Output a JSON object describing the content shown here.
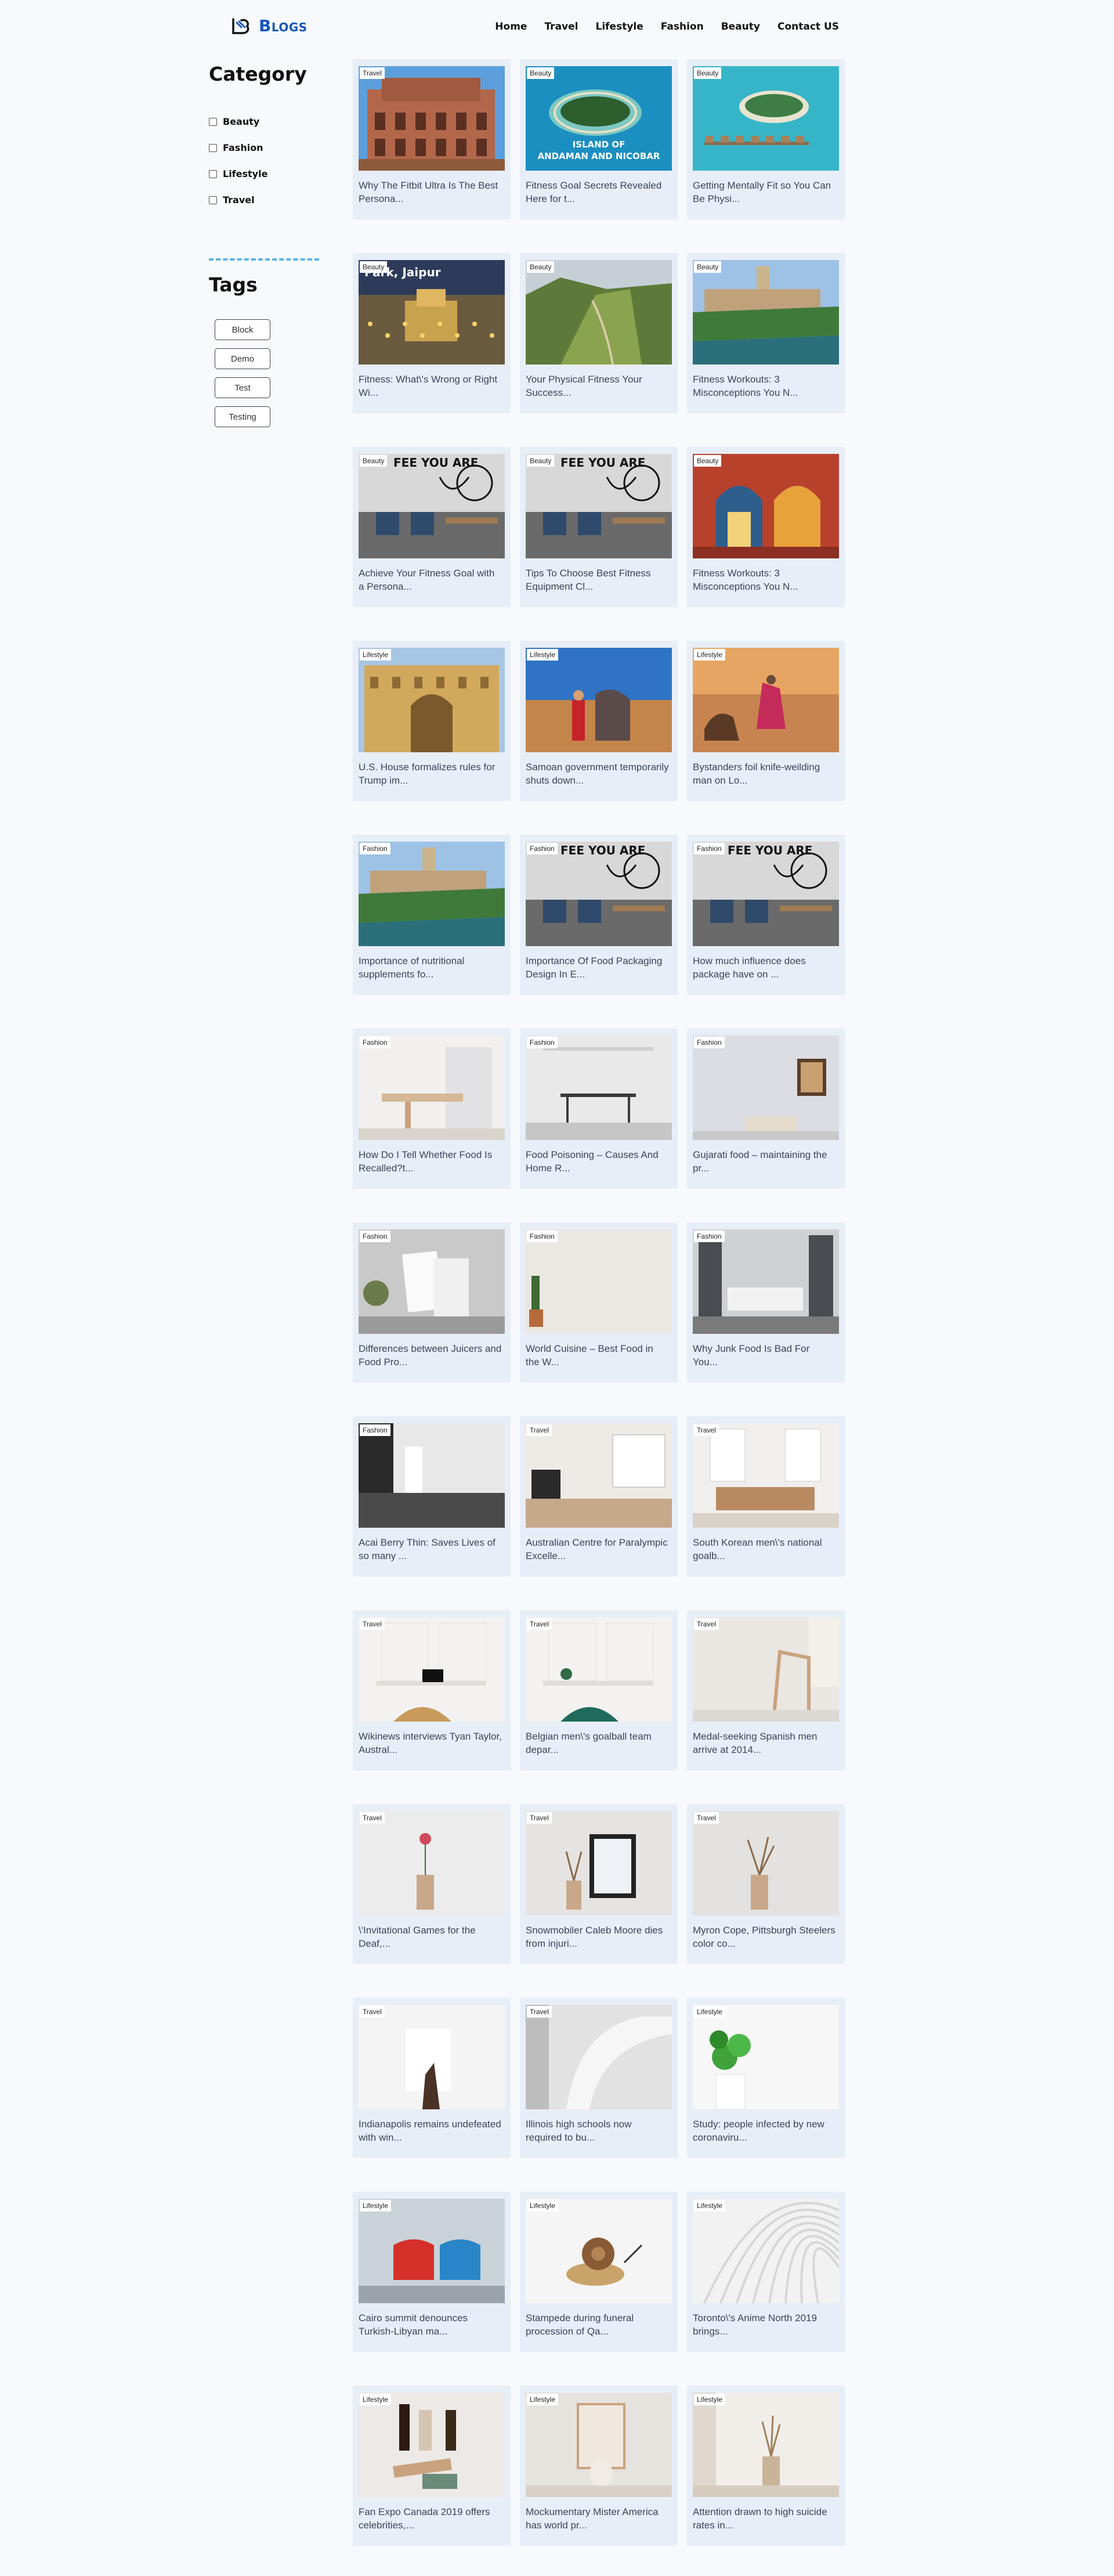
{
  "header": {
    "logo_text": "Blogs",
    "nav": [
      "Home",
      "Travel",
      "Lifestyle",
      "Fashion",
      "Beauty",
      "Contact US"
    ]
  },
  "sidebar": {
    "category_title": "Category",
    "categories": [
      "Beauty",
      "Fashion",
      "Lifestyle",
      "Travel"
    ],
    "tags_title": "Tags",
    "tags": [
      "Block",
      "Demo",
      "Test",
      "Testing"
    ]
  },
  "colors": {
    "accent": "#1557b8",
    "card_bg": "#e7eef8",
    "divider": "#5fb3e3"
  },
  "posts": [
    {
      "category": "Travel",
      "title": "Why The Fitbit Ultra Is The Best Persona...",
      "scene": "palace"
    },
    {
      "category": "Beauty",
      "title": "Fitness Goal Secrets Revealed Here for t...",
      "scene": "island",
      "overlay": "ISLAND OF ANDAMAN AND NICOBAR"
    },
    {
      "category": "Beauty",
      "title": "Getting Mentally Fit so You Can Be Physi...",
      "scene": "resort"
    },
    {
      "category": "Beauty",
      "title": "Fitness: What\\'s Wrong or Right Wi...",
      "scene": "jaipur",
      "overlay": "Park, Jaipur"
    },
    {
      "category": "Beauty",
      "title": "Your Physical Fitness Your Success...",
      "scene": "hill"
    },
    {
      "category": "Beauty",
      "title": "Fitness Workouts: 3 Misconceptions You N...",
      "scene": "fort"
    },
    {
      "category": "Beauty",
      "title": "Achieve Your Fitness Goal with a Persona...",
      "scene": "cafe",
      "overlay": "FEE YOU ARE"
    },
    {
      "category": "Beauty",
      "title": "Tips To Choose Best Fitness Equipment Cl...",
      "scene": "cafe",
      "overlay": "FEE YOU ARE"
    },
    {
      "category": "Beauty",
      "title": "Fitness Workouts: 3 Misconceptions You N...",
      "scene": "haveli"
    },
    {
      "category": "Lifestyle",
      "title": "U.S. House formalizes rules for Trump im...",
      "scene": "amber"
    },
    {
      "category": "Lifestyle",
      "title": "Samoan government temporarily shuts down...",
      "scene": "elephant"
    },
    {
      "category": "Lifestyle",
      "title": "Bystanders foil knife-weilding man on Lo...",
      "scene": "desert"
    },
    {
      "category": "Fashion",
      "title": "Importance of nutritional supplements fo...",
      "scene": "fort"
    },
    {
      "category": "Fashion",
      "title": "Importance Of Food Packaging Design In E...",
      "scene": "cafe",
      "overlay": "FEE YOU ARE"
    },
    {
      "category": "Fashion",
      "title": "How much influence does package have on ...",
      "scene": "cafe",
      "overlay": "FEE YOU ARE"
    },
    {
      "category": "Fashion",
      "title": "How Do I Tell Whether Food Is Recalled?t...",
      "scene": "kitchen"
    },
    {
      "category": "Fashion",
      "title": "Food Poisoning – Causes And Home R...",
      "scene": "dining"
    },
    {
      "category": "Fashion",
      "title": "Gujarati food – maintaining the pr...",
      "scene": "frame"
    },
    {
      "category": "Fashion",
      "title": "Differences between Juicers and Food Pro...",
      "scene": "canvas"
    },
    {
      "category": "Fashion",
      "title": "World Cuisine – Best Food in the W...",
      "scene": "cactus"
    },
    {
      "category": "Fashion",
      "title": "Why Junk Food Is Bad For You...",
      "scene": "bedroom"
    },
    {
      "category": "Fashion",
      "title": "Acai Berry Thin: Saves Lives of so many ...",
      "scene": "emptyroom"
    },
    {
      "category": "Travel",
      "title": "Australian Centre for Paralympic Excelle...",
      "scene": "livingroom"
    },
    {
      "category": "Travel",
      "title": "South Korean men\\'s national goalb...",
      "scene": "sofa"
    },
    {
      "category": "Travel",
      "title": "Wikinews interviews Tyan Taylor, Austral...",
      "scene": "desk"
    },
    {
      "category": "Travel",
      "title": "Belgian men\\'s goalball team depar...",
      "scene": "console"
    },
    {
      "category": "Travel",
      "title": "Medal-seeking Spanish men arrive at 2014...",
      "scene": "chair"
    },
    {
      "category": "Travel",
      "title": "\\'Invitational Games for the Deaf,...",
      "scene": "vase"
    },
    {
      "category": "Travel",
      "title": "Snowmobiler Caleb Moore dies from injuri...",
      "scene": "vaseframe"
    },
    {
      "category": "Travel",
      "title": "Myron Cope, Pittsburgh Steelers color co...",
      "scene": "vase2"
    },
    {
      "category": "Travel",
      "title": "Indianapolis remains undefeated with win...",
      "scene": "hand"
    },
    {
      "category": "Travel",
      "title": "Illinois high schools now required to bu...",
      "scene": "curve"
    },
    {
      "category": "Lifestyle",
      "title": "Study: people infected by new coronaviru...",
      "scene": "plant"
    },
    {
      "category": "Lifestyle",
      "title": "Cairo summit denounces Turkish-Libyan ma...",
      "scene": "chairs"
    },
    {
      "category": "Lifestyle",
      "title": "Stampede during funeral procession of Qa...",
      "scene": "snail"
    },
    {
      "category": "Lifestyle",
      "title": "Toronto\\'s Anime North 2019 brings...",
      "scene": "arch"
    },
    {
      "category": "Lifestyle",
      "title": "Fan Expo Canada 2019 offers celebrities,...",
      "scene": "bottles"
    },
    {
      "category": "Lifestyle",
      "title": "Mockumentary Mister America has world pr...",
      "scene": "mirror"
    },
    {
      "category": "Lifestyle",
      "title": "Attention drawn to high suicide rates in...",
      "scene": "dried"
    }
  ]
}
